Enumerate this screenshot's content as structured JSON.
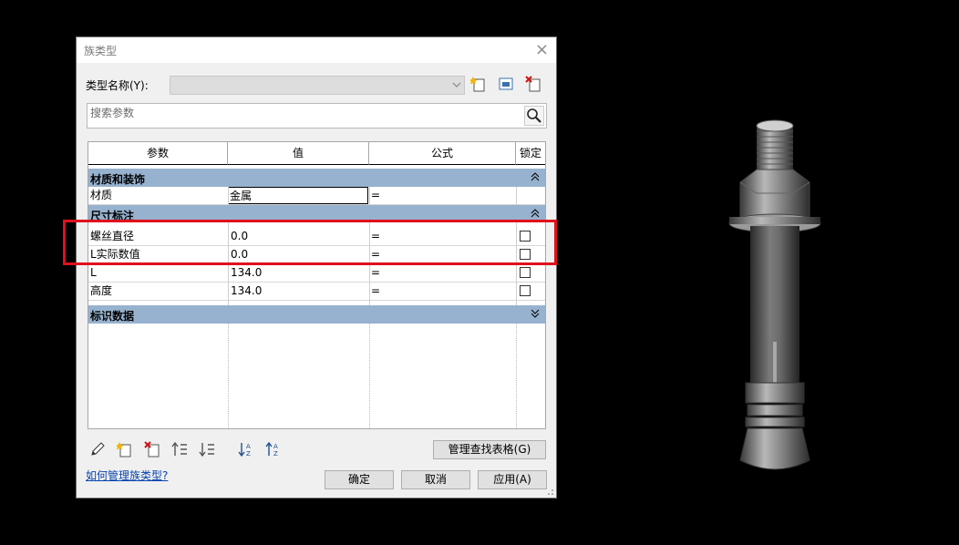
{
  "dialog": {
    "title": "族类型",
    "close_glyph": "×",
    "type_name_label": "类型名称(Y):",
    "type_name_value": "",
    "search_placeholder": "搜索参数",
    "columns": [
      "参数",
      "值",
      "公式",
      "锁定"
    ],
    "groups": [
      {
        "name": "材质和装饰",
        "rows": [
          {
            "param": "材质",
            "value": "金属",
            "formula": "=",
            "lock": false
          }
        ]
      },
      {
        "name": "尺寸标注",
        "rows": [
          {
            "param": "螺丝直径",
            "value": "0.0",
            "formula": "=",
            "lock": false
          },
          {
            "param": "L实际数值",
            "value": "0.0",
            "formula": "=",
            "lock": false
          },
          {
            "param": "L",
            "value": "134.0",
            "formula": "=",
            "lock": false
          },
          {
            "param": "高度",
            "value": "134.0",
            "formula": "=",
            "lock": false
          }
        ]
      },
      {
        "name": "标识数据",
        "rows": []
      }
    ],
    "manage_lookup_label": "管理查找表格(G)",
    "help_link": "如何管理族类型?",
    "ok_label": "确定",
    "cancel_label": "取消",
    "apply_label": "应用(A)"
  },
  "colors": {
    "highlight_box": "#e0101c",
    "group_header": "#97b2cf"
  },
  "icons": [
    "new-type-icon",
    "rename-type-icon",
    "delete-type-icon",
    "search-icon",
    "pencil-icon",
    "new-parameter-icon",
    "delete-parameter-icon",
    "move-up-icon",
    "move-down-icon",
    "sort-ascending-icon",
    "sort-descending-icon",
    "dropdown-arrow-icon",
    "collapse-icon",
    "expand-icon"
  ]
}
